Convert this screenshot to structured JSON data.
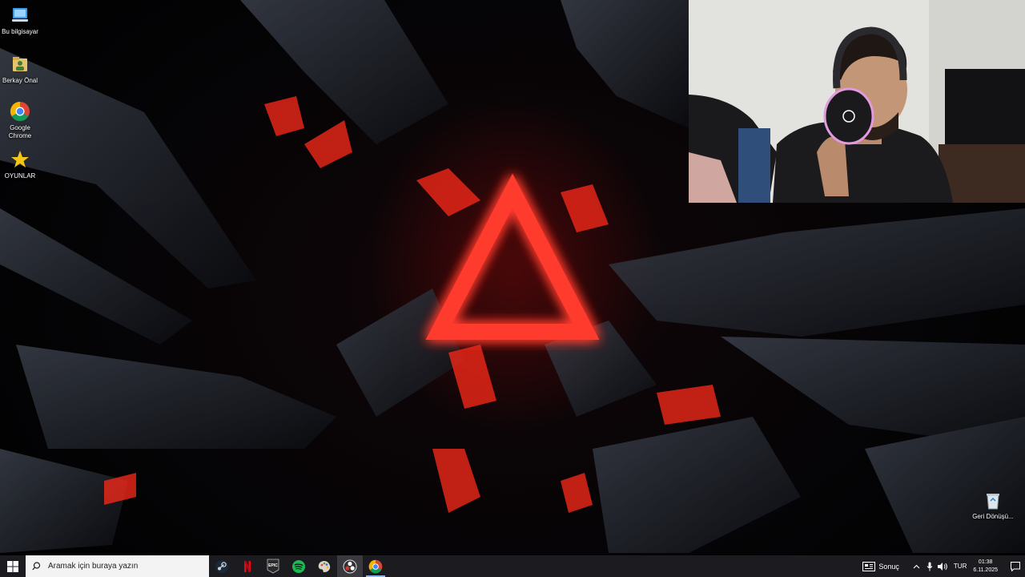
{
  "desktop": {
    "icons": [
      {
        "label": "Bu bilgisayar",
        "icon": "this-pc-icon"
      },
      {
        "label": "Berkay Önal",
        "icon": "user-folder-icon"
      },
      {
        "label": "Google Chrome",
        "icon": "chrome-icon"
      },
      {
        "label": "OYUNLAR",
        "icon": "star-icon"
      }
    ],
    "recycle_bin": {
      "label": "Geri Dönüşü...",
      "icon": "recycle-bin-icon"
    }
  },
  "taskbar": {
    "search_placeholder": "Aramak için buraya yazın",
    "apps": [
      {
        "name": "Steam",
        "icon": "steam-icon"
      },
      {
        "name": "Netflix",
        "icon": "netflix-icon"
      },
      {
        "name": "Epic Games",
        "icon": "epic-games-icon",
        "text": "EPIC"
      },
      {
        "name": "Spotify",
        "icon": "spotify-icon"
      },
      {
        "name": "App",
        "icon": "palette-icon"
      },
      {
        "name": "OBS",
        "icon": "obs-icon",
        "active": true
      },
      {
        "name": "Google Chrome",
        "icon": "chrome-icon",
        "running": true
      }
    ],
    "weather_label": "Sonuç",
    "language": "TUR",
    "time": "01:38",
    "date": "6.11.2025"
  },
  "colors": {
    "accent_red": "#ff3b2f",
    "taskbar_bg": "#1c1b20"
  }
}
